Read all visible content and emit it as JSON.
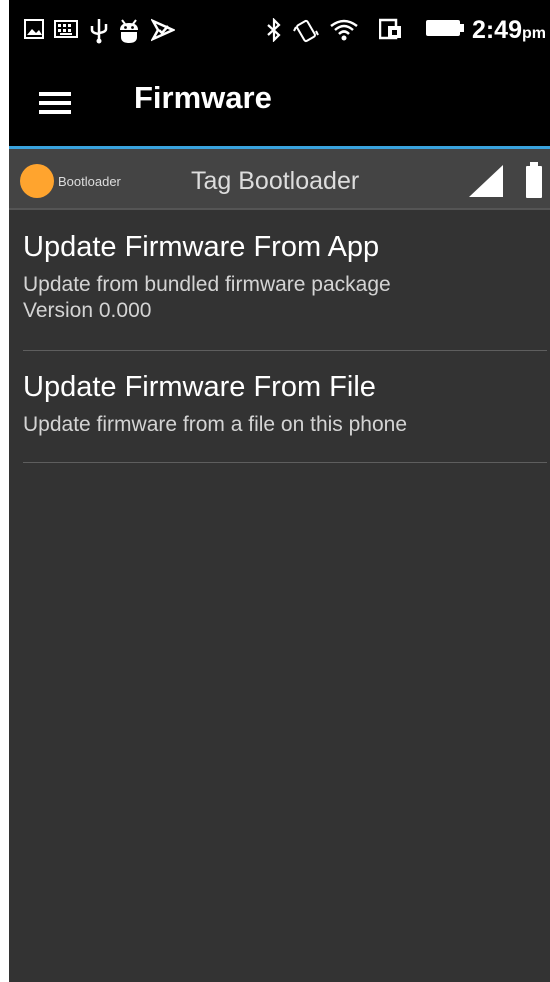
{
  "status_bar": {
    "time": "2:49",
    "ampm": "pm",
    "icons": [
      "image-icon",
      "keyboard-icon",
      "usb-icon",
      "android-debug-icon",
      "check-shield-icon",
      "bluetooth-icon",
      "vibrate-icon",
      "wifi-icon",
      "cast-icon",
      "battery-icon"
    ]
  },
  "app_bar": {
    "title": "Firmware"
  },
  "device": {
    "tag": "Bootloader",
    "name": "Tag Bootloader",
    "status_color": "#ffa42e"
  },
  "list": {
    "items": [
      {
        "title": "Update Firmware From App",
        "subtitle_lines": [
          "Update from bundled firmware package",
          "Version 0.000"
        ]
      },
      {
        "title": "Update Firmware From File",
        "subtitle_lines": [
          "Update firmware from a file on this phone"
        ]
      }
    ]
  },
  "colors": {
    "accent": "#3aa3dd",
    "background": "#333333"
  }
}
